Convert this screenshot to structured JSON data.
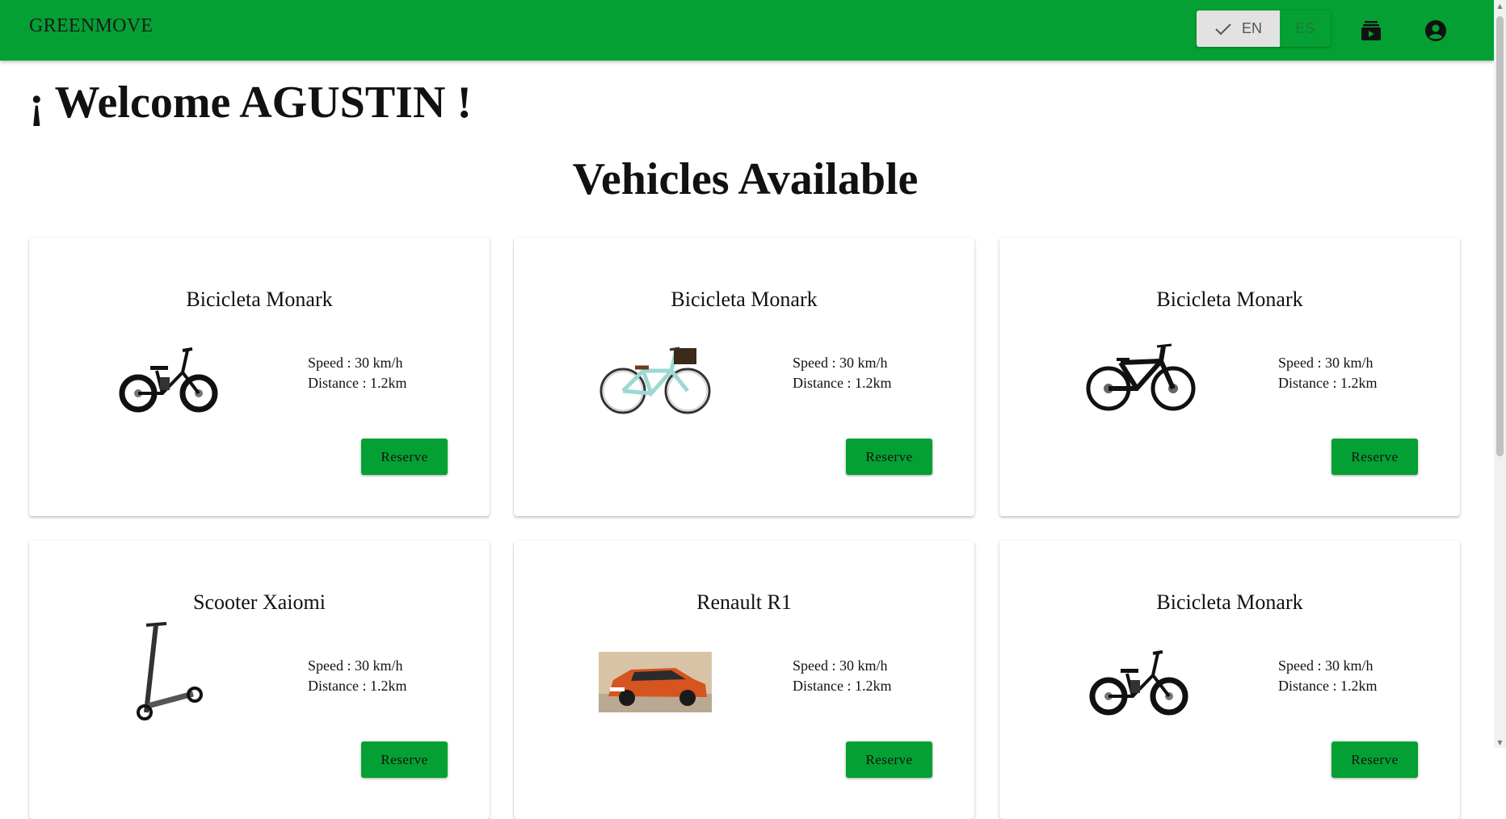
{
  "header": {
    "brand": "GREENMOVE",
    "languages": [
      {
        "code": "EN",
        "selected": true
      },
      {
        "code": "ES",
        "selected": false
      }
    ],
    "icons": [
      "reservations-icon",
      "account-icon"
    ],
    "accent_color": "#04a034"
  },
  "welcome": "¡ Welcome AGUSTIN !",
  "section_title": "Vehicles Available",
  "cards": [
    {
      "title": "Bicicleta Monark",
      "speed": "Speed : 30 km/h",
      "distance": "Distance : 1.2km",
      "button": "Reserve",
      "image": "electric-folding-bike"
    },
    {
      "title": "Bicicleta Monark",
      "speed": "Speed : 30 km/h",
      "distance": "Distance : 1.2km",
      "button": "Reserve",
      "image": "city-bike-with-basket"
    },
    {
      "title": "Bicicleta Monark",
      "speed": "Speed : 30 km/h",
      "distance": "Distance : 1.2km",
      "button": "Reserve",
      "image": "folding-mountain-bike"
    },
    {
      "title": "Scooter Xaiomi",
      "speed": "Speed : 30 km/h",
      "distance": "Distance : 1.2km",
      "button": "Reserve",
      "image": "electric-scooter"
    },
    {
      "title": "Renault R1",
      "speed": "Speed : 30 km/h",
      "distance": "Distance : 1.2km",
      "button": "Reserve",
      "image": "orange-car"
    },
    {
      "title": "Bicicleta Monark",
      "speed": "Speed : 30 km/h",
      "distance": "Distance : 1.2km",
      "button": "Reserve",
      "image": "electric-folding-bike"
    }
  ]
}
